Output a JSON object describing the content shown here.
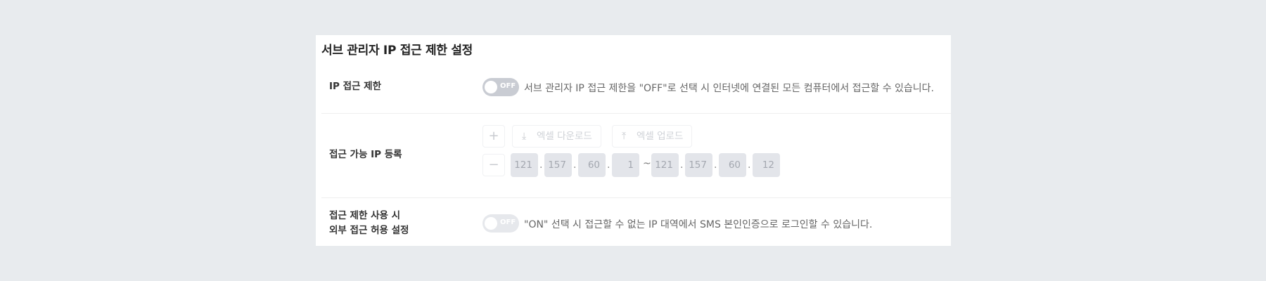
{
  "title": "서브 관리자 IP 접근 제한 설정",
  "rows": {
    "ip_restrict": {
      "label": "IP 접근 제한",
      "toggle_state": "OFF",
      "description": "서브 관리자 IP 접근 제한을 \"OFF\"로 선택 시 인터넷에 연결된 모든 컴퓨터에서 접근할 수 있습니다."
    },
    "allowed_ip": {
      "label": "접근 가능 IP 등록",
      "add_icon": "plus-icon",
      "remove_icon": "minus-icon",
      "excel_download_label": "엑셀 다운로드",
      "excel_download_icon": "download-icon",
      "excel_upload_label": "엑셀 업로드",
      "excel_upload_icon": "upload-icon",
      "range_separator": "~",
      "ip_start": [
        "121",
        "157",
        "60",
        "1"
      ],
      "ip_end": [
        "121",
        "157",
        "60",
        "12"
      ]
    },
    "external_access": {
      "label_line1": "접근 제한 사용 시",
      "label_line2": "외부 접근 허용 설정",
      "toggle_state": "OFF",
      "description": "\"ON\" 선택 시 접근할 수 없는 IP 대역에서 SMS 본인인증으로 로그인할 수 있습니다."
    }
  },
  "colors": {
    "background": "#e8ebee",
    "panel": "#ffffff",
    "toggle_off": "#c9ccd3",
    "ip_box": "#e3e5ea"
  }
}
